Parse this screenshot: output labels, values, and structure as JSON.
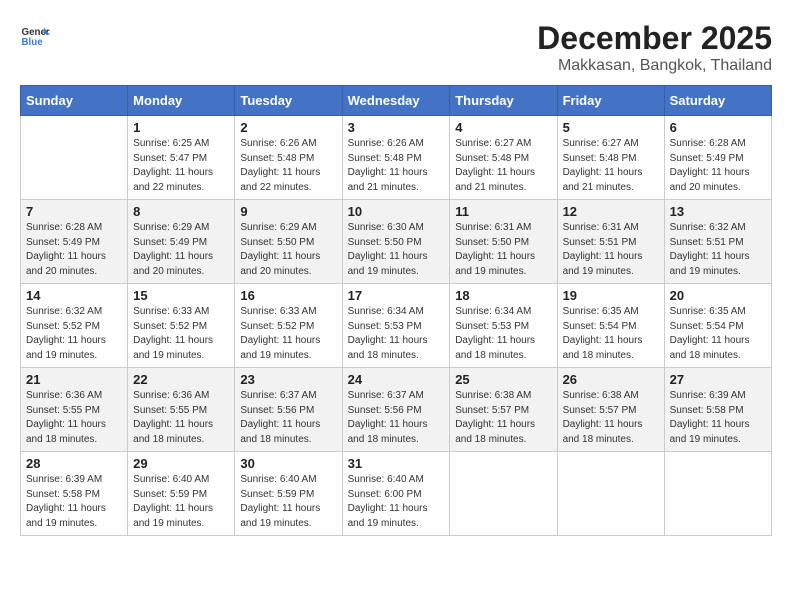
{
  "logo": {
    "general": "General",
    "blue": "Blue"
  },
  "title": "December 2025",
  "subtitle": "Makkasan, Bangkok, Thailand",
  "days_of_week": [
    "Sunday",
    "Monday",
    "Tuesday",
    "Wednesday",
    "Thursday",
    "Friday",
    "Saturday"
  ],
  "weeks": [
    [
      {
        "day": "",
        "info": ""
      },
      {
        "day": "1",
        "info": "Sunrise: 6:25 AM\nSunset: 5:47 PM\nDaylight: 11 hours\nand 22 minutes."
      },
      {
        "day": "2",
        "info": "Sunrise: 6:26 AM\nSunset: 5:48 PM\nDaylight: 11 hours\nand 22 minutes."
      },
      {
        "day": "3",
        "info": "Sunrise: 6:26 AM\nSunset: 5:48 PM\nDaylight: 11 hours\nand 21 minutes."
      },
      {
        "day": "4",
        "info": "Sunrise: 6:27 AM\nSunset: 5:48 PM\nDaylight: 11 hours\nand 21 minutes."
      },
      {
        "day": "5",
        "info": "Sunrise: 6:27 AM\nSunset: 5:48 PM\nDaylight: 11 hours\nand 21 minutes."
      },
      {
        "day": "6",
        "info": "Sunrise: 6:28 AM\nSunset: 5:49 PM\nDaylight: 11 hours\nand 20 minutes."
      }
    ],
    [
      {
        "day": "7",
        "info": "Sunrise: 6:28 AM\nSunset: 5:49 PM\nDaylight: 11 hours\nand 20 minutes."
      },
      {
        "day": "8",
        "info": "Sunrise: 6:29 AM\nSunset: 5:49 PM\nDaylight: 11 hours\nand 20 minutes."
      },
      {
        "day": "9",
        "info": "Sunrise: 6:29 AM\nSunset: 5:50 PM\nDaylight: 11 hours\nand 20 minutes."
      },
      {
        "day": "10",
        "info": "Sunrise: 6:30 AM\nSunset: 5:50 PM\nDaylight: 11 hours\nand 19 minutes."
      },
      {
        "day": "11",
        "info": "Sunrise: 6:31 AM\nSunset: 5:50 PM\nDaylight: 11 hours\nand 19 minutes."
      },
      {
        "day": "12",
        "info": "Sunrise: 6:31 AM\nSunset: 5:51 PM\nDaylight: 11 hours\nand 19 minutes."
      },
      {
        "day": "13",
        "info": "Sunrise: 6:32 AM\nSunset: 5:51 PM\nDaylight: 11 hours\nand 19 minutes."
      }
    ],
    [
      {
        "day": "14",
        "info": "Sunrise: 6:32 AM\nSunset: 5:52 PM\nDaylight: 11 hours\nand 19 minutes."
      },
      {
        "day": "15",
        "info": "Sunrise: 6:33 AM\nSunset: 5:52 PM\nDaylight: 11 hours\nand 19 minutes."
      },
      {
        "day": "16",
        "info": "Sunrise: 6:33 AM\nSunset: 5:52 PM\nDaylight: 11 hours\nand 19 minutes."
      },
      {
        "day": "17",
        "info": "Sunrise: 6:34 AM\nSunset: 5:53 PM\nDaylight: 11 hours\nand 18 minutes."
      },
      {
        "day": "18",
        "info": "Sunrise: 6:34 AM\nSunset: 5:53 PM\nDaylight: 11 hours\nand 18 minutes."
      },
      {
        "day": "19",
        "info": "Sunrise: 6:35 AM\nSunset: 5:54 PM\nDaylight: 11 hours\nand 18 minutes."
      },
      {
        "day": "20",
        "info": "Sunrise: 6:35 AM\nSunset: 5:54 PM\nDaylight: 11 hours\nand 18 minutes."
      }
    ],
    [
      {
        "day": "21",
        "info": "Sunrise: 6:36 AM\nSunset: 5:55 PM\nDaylight: 11 hours\nand 18 minutes."
      },
      {
        "day": "22",
        "info": "Sunrise: 6:36 AM\nSunset: 5:55 PM\nDaylight: 11 hours\nand 18 minutes."
      },
      {
        "day": "23",
        "info": "Sunrise: 6:37 AM\nSunset: 5:56 PM\nDaylight: 11 hours\nand 18 minutes."
      },
      {
        "day": "24",
        "info": "Sunrise: 6:37 AM\nSunset: 5:56 PM\nDaylight: 11 hours\nand 18 minutes."
      },
      {
        "day": "25",
        "info": "Sunrise: 6:38 AM\nSunset: 5:57 PM\nDaylight: 11 hours\nand 18 minutes."
      },
      {
        "day": "26",
        "info": "Sunrise: 6:38 AM\nSunset: 5:57 PM\nDaylight: 11 hours\nand 18 minutes."
      },
      {
        "day": "27",
        "info": "Sunrise: 6:39 AM\nSunset: 5:58 PM\nDaylight: 11 hours\nand 19 minutes."
      }
    ],
    [
      {
        "day": "28",
        "info": "Sunrise: 6:39 AM\nSunset: 5:58 PM\nDaylight: 11 hours\nand 19 minutes."
      },
      {
        "day": "29",
        "info": "Sunrise: 6:40 AM\nSunset: 5:59 PM\nDaylight: 11 hours\nand 19 minutes."
      },
      {
        "day": "30",
        "info": "Sunrise: 6:40 AM\nSunset: 5:59 PM\nDaylight: 11 hours\nand 19 minutes."
      },
      {
        "day": "31",
        "info": "Sunrise: 6:40 AM\nSunset: 6:00 PM\nDaylight: 11 hours\nand 19 minutes."
      },
      {
        "day": "",
        "info": ""
      },
      {
        "day": "",
        "info": ""
      },
      {
        "day": "",
        "info": ""
      }
    ]
  ]
}
